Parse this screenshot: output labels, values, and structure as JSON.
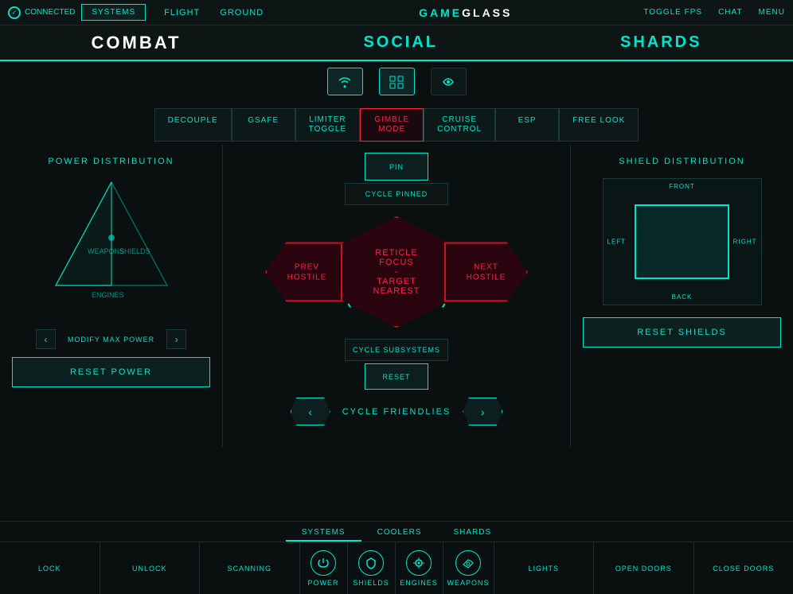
{
  "topbar": {
    "connected": "CONNECTED",
    "title": "GAME",
    "title_bold": "GLASS",
    "toggle_fps": "TOGGLE FPS",
    "chat": "CHAT",
    "menu": "MENU"
  },
  "nav": {
    "systems": "SYSTEMS",
    "flight": "FLIGHT",
    "ground": "GROUND",
    "combat": "COMBAT",
    "social": "SOCIAL",
    "shards": "SHARDS"
  },
  "toggles": [
    {
      "label": "DECOUPLE",
      "active": false
    },
    {
      "label": "GSAFE",
      "active": false
    },
    {
      "label": "LIMITER\nTOGGLE",
      "active": false
    },
    {
      "label": "GIMBLE\nMODE",
      "active": true
    },
    {
      "label": "CRUISE\nCONTROL",
      "active": false
    },
    {
      "label": "ESP",
      "active": false
    },
    {
      "label": "FREE LOOK",
      "active": false
    }
  ],
  "power_panel": {
    "title": "POWER DISTRIBUTION",
    "weapons_label": "WEAPONS",
    "shields_label": "SHIELDS",
    "engines_label": "ENGINES",
    "modify_label": "MODIFY MAX POWER",
    "reset_label": "RESET POWER"
  },
  "shield_panel": {
    "title": "SHIELD DISTRIBUTION",
    "front": "FRONT",
    "back": "BACK",
    "left": "LEFT",
    "right": "RIGHT",
    "reset_label": "RESET SHIELDS"
  },
  "combat": {
    "pin": "PIN",
    "cycle_pinned": "CYCLE PINNED",
    "reticle_focus": "RETICLE\nFOCUS\n-\nTARGET\nNEAREST",
    "reticle_line1": "RETICLE",
    "reticle_line2": "FOCUS",
    "reticle_sep": "-",
    "reticle_line3": "TARGET",
    "reticle_line4": "NEAREST",
    "prev_hostile": "PREV\nHOSTILE",
    "next_hostile": "NEXT\nHOSTILE",
    "cycle_subsystems": "CYCLE SUBSYSTEMS",
    "reset": "RESET",
    "cycle_friendlies": "CYCLE FRIENDLIES"
  },
  "bottom_tabs": [
    {
      "label": "SYSTEMS",
      "active": true
    },
    {
      "label": "COOLERS",
      "active": false
    },
    {
      "label": "SHARDS",
      "active": false
    }
  ],
  "bottom_actions": [
    {
      "label": "LOCK",
      "icon": "lock"
    },
    {
      "label": "UNLOCK",
      "icon": "unlock"
    },
    {
      "label": "SCANNING",
      "icon": "scan"
    },
    {
      "label": "POWER",
      "icon": "power",
      "has_icon": true
    },
    {
      "label": "SHIELDS",
      "icon": "shield",
      "has_icon": true
    },
    {
      "label": "ENGINES",
      "icon": "engine",
      "has_icon": true
    },
    {
      "label": "WEAPONS",
      "icon": "weapon",
      "has_icon": true
    },
    {
      "label": "LIGHTS",
      "icon": "lights"
    },
    {
      "label": "OPEN DOORS",
      "icon": "door-open"
    },
    {
      "label": "CLOSE DOORS",
      "icon": "door-close"
    }
  ]
}
